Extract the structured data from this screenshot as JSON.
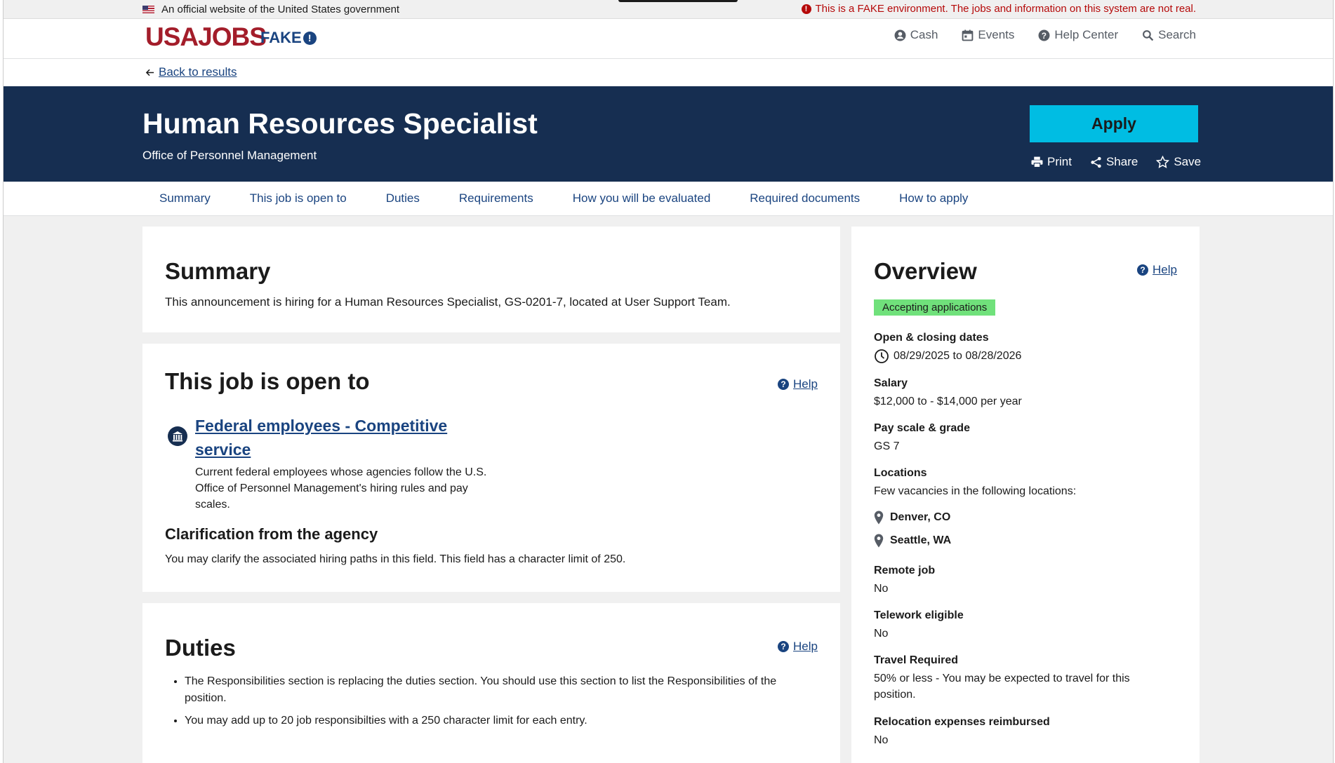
{
  "banner": {
    "official_text": "An official website of the United States government",
    "fake_warning": "This is a FAKE environment. The jobs and information on this system are not real."
  },
  "header": {
    "logo": "USAJOBS",
    "fake_label": "FAKE",
    "nav": [
      {
        "label": "Cash",
        "icon": "user-circle-icon"
      },
      {
        "label": "Events",
        "icon": "calendar-icon"
      },
      {
        "label": "Help Center",
        "icon": "help-icon"
      },
      {
        "label": "Search",
        "icon": "search-icon"
      }
    ]
  },
  "back_link": "Back to results",
  "hero": {
    "title": "Human Resources Specialist",
    "agency": "Office of Personnel Management",
    "apply_label": "Apply",
    "actions": [
      "Print",
      "Share",
      "Save"
    ]
  },
  "tabs": [
    "Summary",
    "This job is open to",
    "Duties",
    "Requirements",
    "How you will be evaluated",
    "Required documents",
    "How to apply"
  ],
  "summary": {
    "heading": "Summary",
    "text": "This announcement is hiring for a Human Resources Specialist, GS-0201-7, located at User Support Team."
  },
  "open_to": {
    "heading": "This job is open to",
    "help": "Help",
    "hiring_path_title": "Federal employees - Competitive service",
    "hiring_path_desc": "Current federal employees whose agencies follow the U.S. Office of Personnel Management's hiring rules and pay scales.",
    "clarification_title": "Clarification from the agency",
    "clarification_text": "You may clarify the associated hiring paths in this field. This field has a character limit of 250."
  },
  "duties": {
    "heading": "Duties",
    "help": "Help",
    "items": [
      "The Responsibilities section is replacing the duties section. You should use this section to list the Responsibilities of the position.",
      "You may add up to 20 job responsibilties with a 250 character limit for each entry."
    ]
  },
  "overview": {
    "heading": "Overview",
    "help": "Help",
    "status": "Accepting applications",
    "dates_label": "Open & closing dates",
    "dates": "08/29/2025 to 08/28/2026",
    "salary_label": "Salary",
    "salary": "$12,000 to - $14,000 per year",
    "grade_label": "Pay scale & grade",
    "grade": "GS 7",
    "locations_label": "Locations",
    "locations_text": "Few vacancies in the following locations:",
    "locations": [
      "Denver, CO",
      "Seattle, WA"
    ],
    "remote_label": "Remote job",
    "remote": "No",
    "telework_label": "Telework eligible",
    "telework": "No",
    "travel_label": "Travel Required",
    "travel": "50% or less - You may be expected to travel for this position.",
    "relocation_label": "Relocation expenses reimbursed",
    "relocation": "No"
  },
  "colors": {
    "hero_bg": "#162e51",
    "apply_bg": "#00bde3",
    "link": "#1a4480",
    "brand_red": "#a31d2a",
    "status_green": "#70e17b",
    "warning_red": "#b50909"
  }
}
